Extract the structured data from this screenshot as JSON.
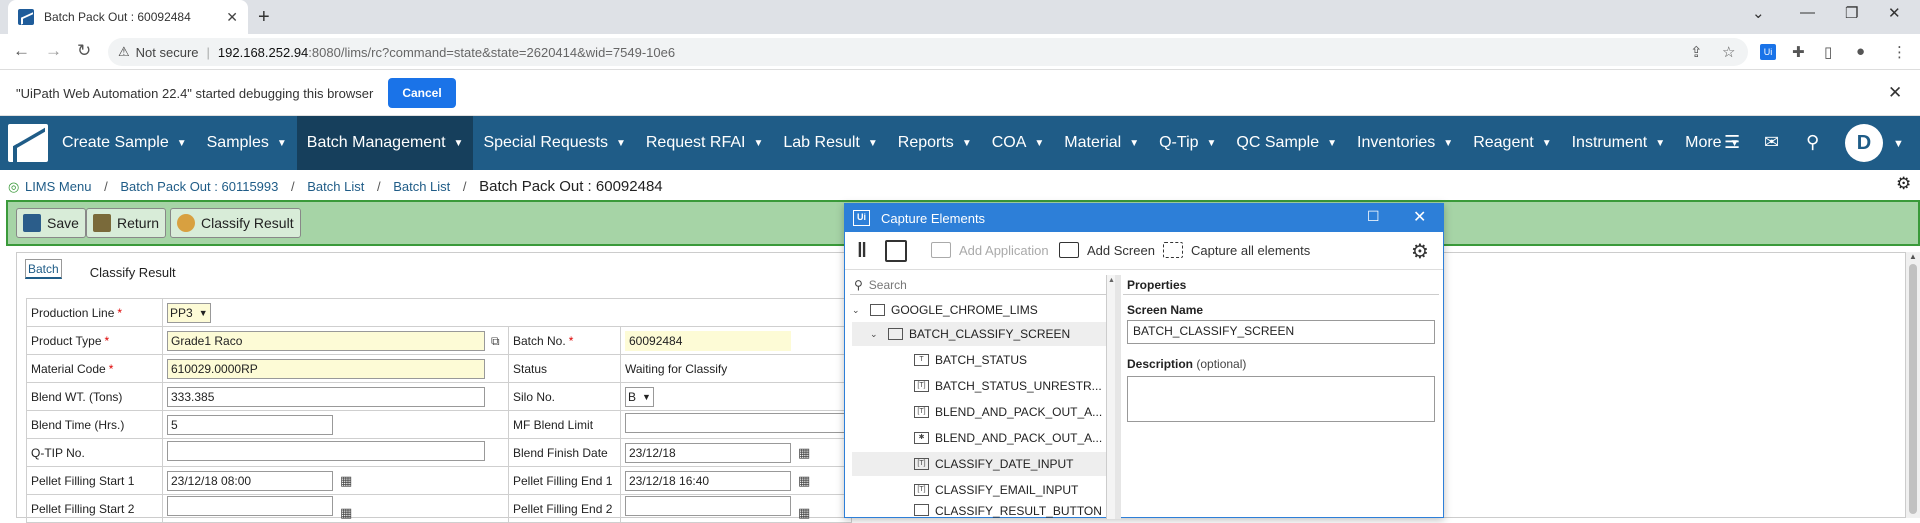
{
  "browser": {
    "tab_title": "Batch Pack Out : 60092484",
    "not_secure": "Not secure",
    "url_host": "192.168.252.94",
    "url_path": ":8080/lims/rc?command=state&state=2620414&wid=7549-10e6"
  },
  "infobar": {
    "message": "\"UiPath Web Automation 22.4\" started debugging this browser",
    "cancel_label": "Cancel"
  },
  "nav": {
    "items": [
      {
        "label": "Create Sample"
      },
      {
        "label": "Samples"
      },
      {
        "label": "Batch Management"
      },
      {
        "label": "Special Requests"
      },
      {
        "label": "Request RFAI"
      },
      {
        "label": "Lab Result"
      },
      {
        "label": "Reports"
      },
      {
        "label": "COA"
      },
      {
        "label": "Material"
      },
      {
        "label": "Q-Tip"
      },
      {
        "label": "QC Sample"
      },
      {
        "label": "Inventories"
      },
      {
        "label": "Reagent"
      },
      {
        "label": "Instrument"
      },
      {
        "label": "More"
      }
    ],
    "active_index": 2,
    "user_initial": "D"
  },
  "breadcrumb": {
    "items": [
      "LIMS Menu",
      "Batch Pack Out : 60115993",
      "Batch List",
      "Batch List"
    ],
    "current": "Batch Pack Out : 60092484"
  },
  "actions": {
    "save": "Save",
    "return": "Return",
    "classify": "Classify Result"
  },
  "form": {
    "tabs": [
      "Batch",
      "Classify Result"
    ],
    "production_line": {
      "label": "Production Line",
      "value": "PP3"
    },
    "product_type": {
      "label": "Product Type",
      "value": "Grade1 Raco"
    },
    "batch_no": {
      "label": "Batch No.",
      "value": "60092484"
    },
    "material_code": {
      "label": "Material Code",
      "value": "610029.0000RP"
    },
    "status": {
      "label": "Status",
      "value": "Waiting for Classify"
    },
    "blend_wt": {
      "label": "Blend WT. (Tons)",
      "value": "333.385"
    },
    "silo_no": {
      "label": "Silo No.",
      "value": "B"
    },
    "blend_time": {
      "label": "Blend Time (Hrs.)",
      "value": "5"
    },
    "mf_blend_limit": {
      "label": "MF Blend Limit",
      "value": ""
    },
    "qtip_no": {
      "label": "Q-TIP No.",
      "value": ""
    },
    "blend_finish_date": {
      "label": "Blend Finish Date",
      "value": "23/12/18"
    },
    "pellet_start_1": {
      "label": "Pellet Filling Start 1",
      "value": "23/12/18 08:00"
    },
    "pellet_end_1": {
      "label": "Pellet Filling End 1",
      "value": "23/12/18 16:40"
    },
    "pellet_start_2": {
      "label": "Pellet Filling Start 2",
      "value": ""
    },
    "pellet_end_2": {
      "label": "Pellet Filling End 2",
      "value": ""
    }
  },
  "capture": {
    "title": "Capture Elements",
    "add_application": "Add Application",
    "add_screen": "Add Screen",
    "capture_all": "Capture all elements",
    "search_placeholder": "Search",
    "tree": [
      {
        "label": "GOOGLE_CHROME_LIMS"
      },
      {
        "label": "BATCH_CLASSIFY_SCREEN"
      },
      {
        "label": "BATCH_STATUS"
      },
      {
        "label": "BATCH_STATUS_UNRESTR..."
      },
      {
        "label": "BLEND_AND_PACK_OUT_A..."
      },
      {
        "label": "BLEND_AND_PACK_OUT_A..."
      },
      {
        "label": "CLASSIFY_DATE_INPUT"
      },
      {
        "label": "CLASSIFY_EMAIL_INPUT"
      },
      {
        "label": "CLASSIFY_RESULT_BUTTON"
      }
    ],
    "properties_header": "Properties",
    "screen_name_label": "Screen Name",
    "screen_name_value": "BATCH_CLASSIFY_SCREEN",
    "description_label": "Description",
    "description_optional": "(optional)"
  }
}
